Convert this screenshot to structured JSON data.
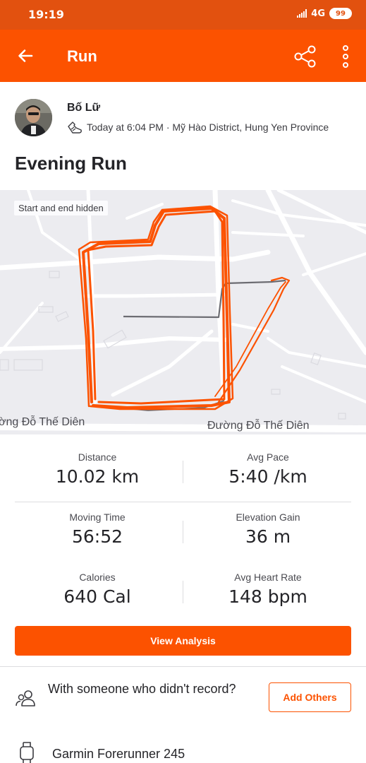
{
  "status_bar": {
    "time": "19:19",
    "network": "4G",
    "battery": "99"
  },
  "app_bar": {
    "title": "Run",
    "back_icon": "arrow-left-icon",
    "share_icon": "share-icon",
    "menu_icon": "more-vertical-icon"
  },
  "athlete": {
    "name": "Bố Lữ",
    "activity_icon": "running-shoe-icon",
    "meta": "Today at 6:04 PM · Mỹ Hào District, Hung Yen Province"
  },
  "activity": {
    "title": "Evening Run"
  },
  "map": {
    "badge": "Start and end hidden",
    "street_left": "ờng Đỗ Thế Diên",
    "street_right": "Đường Đỗ Thế Diên",
    "route_color": "#fc5200"
  },
  "stats": [
    {
      "label": "Distance",
      "value": "10.02 km"
    },
    {
      "label": "Avg Pace",
      "value": "5:40 /km"
    },
    {
      "label": "Moving Time",
      "value": "56:52"
    },
    {
      "label": "Elevation Gain",
      "value": "36 m"
    },
    {
      "label": "Calories",
      "value": "640 Cal"
    },
    {
      "label": "Avg Heart Rate",
      "value": "148 bpm"
    }
  ],
  "actions": {
    "view_analysis": "View Analysis"
  },
  "others": {
    "text": "With someone who didn't record?",
    "button": "Add Others"
  },
  "device": {
    "name": "Garmin Forerunner 245"
  },
  "colors": {
    "accent": "#fc5200",
    "status_bar": "#e2510f"
  }
}
